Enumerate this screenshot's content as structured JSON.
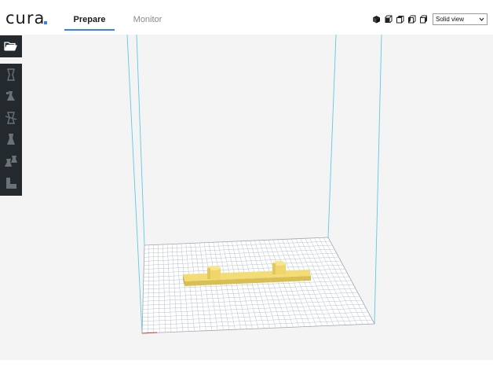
{
  "app": {
    "logo_text": "cura",
    "brand_color": "#3282ff"
  },
  "tabs": [
    {
      "label": "Prepare",
      "active": true
    },
    {
      "label": "Monitor",
      "active": false
    }
  ],
  "view_buttons": [
    {
      "icon": "3d-view-icon"
    },
    {
      "icon": "front-view-icon"
    },
    {
      "icon": "top-view-icon"
    },
    {
      "icon": "left-view-icon"
    },
    {
      "icon": "right-view-icon"
    }
  ],
  "view_mode": {
    "selected": "Solid view"
  },
  "sidebar": {
    "open_file_icon": "folder-open-icon",
    "tools": [
      {
        "icon": "translate-tool-icon"
      },
      {
        "icon": "scale-tool-icon"
      },
      {
        "icon": "rotate-tool-icon"
      },
      {
        "icon": "mirror-tool-icon"
      },
      {
        "icon": "per-model-settings-icon"
      },
      {
        "icon": "support-blocker-icon"
      }
    ]
  },
  "scene": {
    "model_color": "#f3dc76",
    "build_plate_grid_color": "#b8c2cc",
    "build_volume_line_color": "#5ec9e8"
  }
}
